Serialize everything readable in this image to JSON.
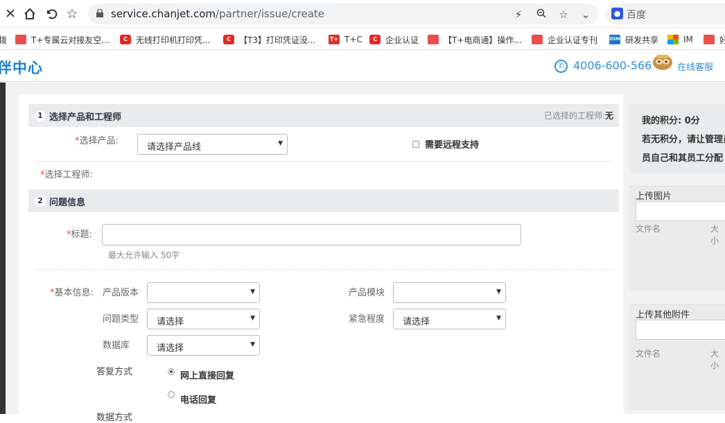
{
  "browser": {
    "url_host": "service.chanjet.com",
    "url_path": "/partner/issue/create",
    "search_placeholder": "百度"
  },
  "bookmarks": [
    {
      "label": "拨",
      "icon": "pink"
    },
    {
      "label": "T+专属云对接友空...",
      "icon": "red-c"
    },
    {
      "label": "无线打印机打印凭...",
      "icon": "red-c"
    },
    {
      "label": "【T3】打印凭证没...",
      "icon": "red-c"
    },
    {
      "label": "T+C",
      "icon": "tplus"
    },
    {
      "label": "企业认证",
      "icon": "red-c"
    },
    {
      "label": "【T+电商通】操作...",
      "icon": "pink"
    },
    {
      "label": "企业认证专刊",
      "icon": "pink"
    },
    {
      "label": "研发共享",
      "icon": "dsm"
    },
    {
      "label": "IM",
      "icon": "ms"
    },
    {
      "label": "好",
      "icon": "pink"
    }
  ],
  "header": {
    "site_title": "伙伴中心",
    "site_title_visible": "伴中心",
    "phone": "4006-600-566",
    "online_service": "在线客服"
  },
  "section1": {
    "num": "1",
    "title": "选择产品和工程师",
    "selected_engineer_label": "已选择的工程师:",
    "selected_engineer_value": "无",
    "product_label": "选择产品:",
    "product_placeholder": "请选择产品线",
    "remote_support": "需要远程支持",
    "engineer_label": "选择工程师:"
  },
  "section2": {
    "num": "2",
    "title": "问题信息",
    "title_label": "标题:",
    "title_hint": "最大允许输入 50字",
    "basic_label": "基本信息:",
    "fields": {
      "product_version": {
        "label": "产品版本",
        "value": ""
      },
      "product_module": {
        "label": "产品模块",
        "value": ""
      },
      "issue_type": {
        "label": "问题类型",
        "value": "请选择"
      },
      "urgency": {
        "label": "紧急程度",
        "value": "请选择"
      },
      "database": {
        "label": "数据库",
        "value": "请选择"
      }
    },
    "reply_label": "答复方式",
    "reply_options": [
      "网上直接回复",
      "电话回复"
    ],
    "data_method_label": "数据方式"
  },
  "sidebar": {
    "points_line": "我的积分:  0分",
    "notice_line1": "若无积分，请让管理员",
    "notice_line2": "员自己和其员工分配",
    "upload_image": {
      "title": "上传图片",
      "col_name": "文件名",
      "col_size": "大小"
    },
    "upload_other": {
      "title": "上传其他附件",
      "col_name": "文件名",
      "col_size": "大小"
    }
  }
}
